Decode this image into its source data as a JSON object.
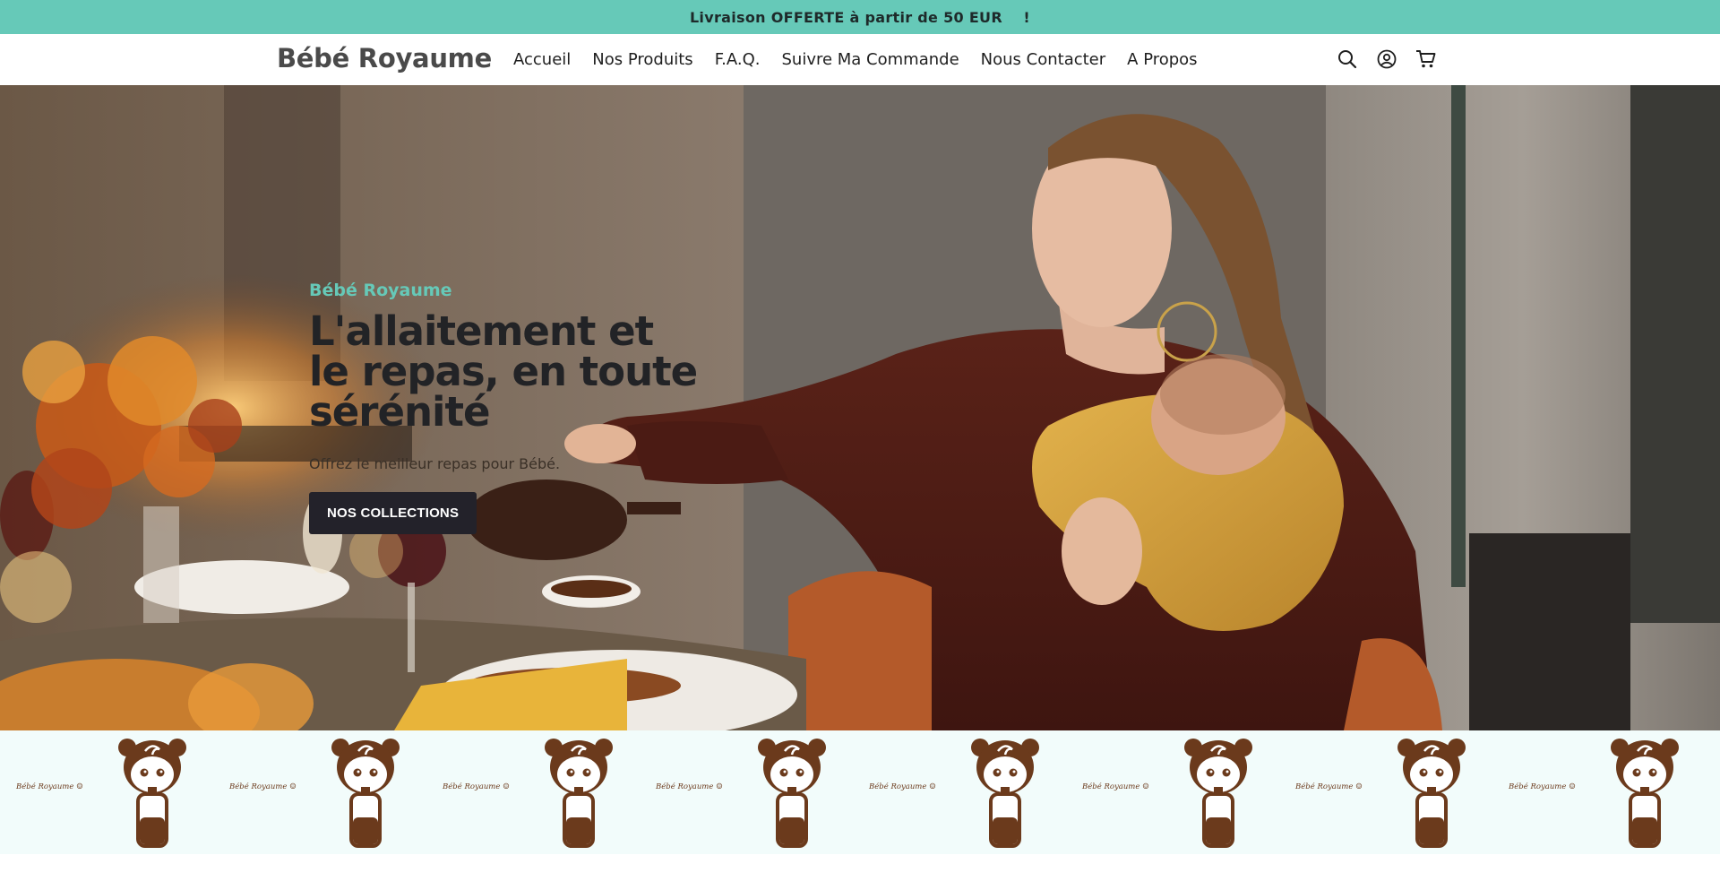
{
  "announcement": {
    "text": "Livraison OFFERTE à partir de 50 EUR    !"
  },
  "header": {
    "logo": "Bébé Royaume",
    "nav": [
      {
        "label": "Accueil"
      },
      {
        "label": "Nos Produits"
      },
      {
        "label": "F.A.Q."
      },
      {
        "label": "Suivre Ma Commande"
      },
      {
        "label": "Nous Contacter"
      },
      {
        "label": "A Propos"
      }
    ],
    "icons": [
      "search-icon",
      "account-icon",
      "cart-icon"
    ]
  },
  "hero": {
    "subheading": "Bébé Royaume",
    "title": "L'allaitement et le repas, en toute sérénité",
    "description": "Offrez le meilleur repas pour Bébé.",
    "button_label": "NOS COLLECTIONS"
  },
  "pattern_band": {
    "mini_logo_text": "Bébé Royaume",
    "icon": "baby-bottle-mascot-icon"
  },
  "colors": {
    "accent": "#66c9b8",
    "button": "#23222a",
    "band_bg": "#f2fcfb",
    "mascot_brown": "#6b3a1c"
  }
}
